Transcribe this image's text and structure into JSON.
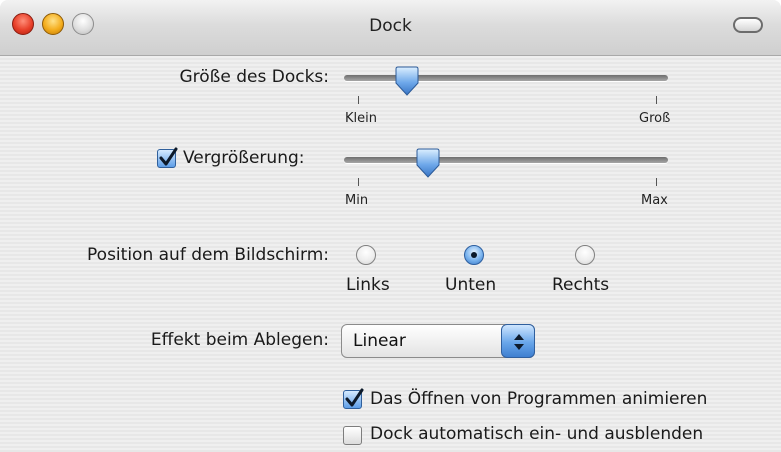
{
  "window": {
    "title": "Dock"
  },
  "dock_size": {
    "label": "Größe des Docks:",
    "min_label": "Klein",
    "max_label": "Groß",
    "value_fraction": 0.2
  },
  "magnification": {
    "label": "Vergrößerung:",
    "checked": true,
    "min_label": "Min",
    "max_label": "Max",
    "value_fraction": 0.27
  },
  "position": {
    "label": "Position auf dem Bildschirm:",
    "options": [
      "Links",
      "Unten",
      "Rechts"
    ],
    "selected": "Unten"
  },
  "minimize_effect": {
    "label": "Effekt beim Ablegen:",
    "value": "Linear"
  },
  "checkboxes": {
    "animate_opening": {
      "label": "Das Öffnen von Programmen animieren",
      "checked": true
    },
    "auto_hide": {
      "label": "Dock automatisch ein- und ausblenden",
      "checked": false
    }
  },
  "colors": {
    "accent": "#4a8fdf",
    "close": "#e8402a",
    "minimize": "#f4ad1d"
  }
}
